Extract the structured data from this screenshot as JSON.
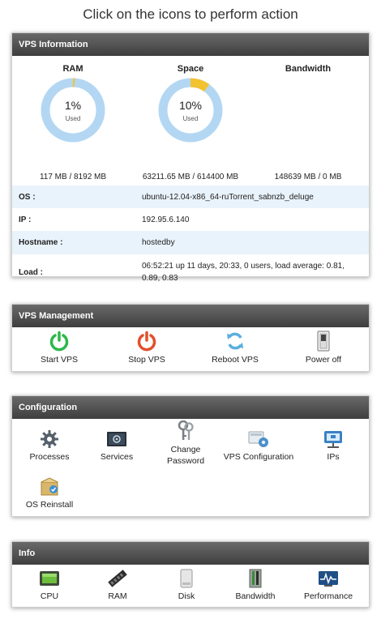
{
  "page_title": "Click on the icons to perform action",
  "vps_info": {
    "header": "VPS Information",
    "gauges": [
      {
        "title": "RAM",
        "percent_label": "1%",
        "fraction": 0.01,
        "used_label": "Used",
        "value": "117 MB / 8192 MB"
      },
      {
        "title": "Space",
        "percent_label": "10%",
        "fraction": 0.1,
        "used_label": "Used",
        "value": "63211.65 MB / 614400 MB"
      },
      {
        "title": "Bandwidth",
        "percent_label": "",
        "fraction": 0,
        "used_label": "",
        "value": "148639 MB / 0 MB"
      }
    ],
    "rows": [
      {
        "key": "OS :",
        "value": "ubuntu-12.04-x86_64-ruTorrent_sabnzb_deluge"
      },
      {
        "key": "IP :",
        "value": "192.95.6.140"
      },
      {
        "key": "Hostname :",
        "value": "hostedby"
      },
      {
        "key": "Load :",
        "value": "06:52:21 up 11 days, 20:33, 0 users, load average: 0.81, 0.89, 0.83"
      }
    ]
  },
  "vps_management": {
    "header": "VPS Management",
    "items": [
      {
        "label": "Start VPS",
        "icon": "power-on-icon"
      },
      {
        "label": "Stop VPS",
        "icon": "power-off-icon"
      },
      {
        "label": "Reboot VPS",
        "icon": "reboot-icon"
      },
      {
        "label": "Power off",
        "icon": "switch-icon"
      }
    ]
  },
  "configuration": {
    "header": "Configuration",
    "items": [
      {
        "label": "Processes",
        "icon": "gear-icon"
      },
      {
        "label": "Services",
        "icon": "services-icon"
      },
      {
        "label": "Change\nPassword",
        "icon": "keys-icon"
      },
      {
        "label": "VPS Configuration",
        "icon": "vps-config-icon"
      },
      {
        "label": "IPs",
        "icon": "network-icon"
      },
      {
        "label": "OS Reinstall",
        "icon": "os-reinstall-icon"
      }
    ]
  },
  "info": {
    "header": "Info",
    "items": [
      {
        "label": "CPU",
        "icon": "cpu-icon"
      },
      {
        "label": "RAM",
        "icon": "ram-icon"
      },
      {
        "label": "Disk",
        "icon": "disk-icon"
      },
      {
        "label": "Bandwidth",
        "icon": "bandwidth-icon"
      },
      {
        "label": "Performance",
        "icon": "performance-icon"
      }
    ]
  },
  "colors": {
    "ring_track": "#b3d7f3",
    "ring_fill": "#f2c230",
    "row_alt": "#e9f3fb",
    "header_dark": "#3e3e3e",
    "power_on": "#2db84a",
    "power_off": "#e2502b",
    "reboot": "#5aaede"
  }
}
